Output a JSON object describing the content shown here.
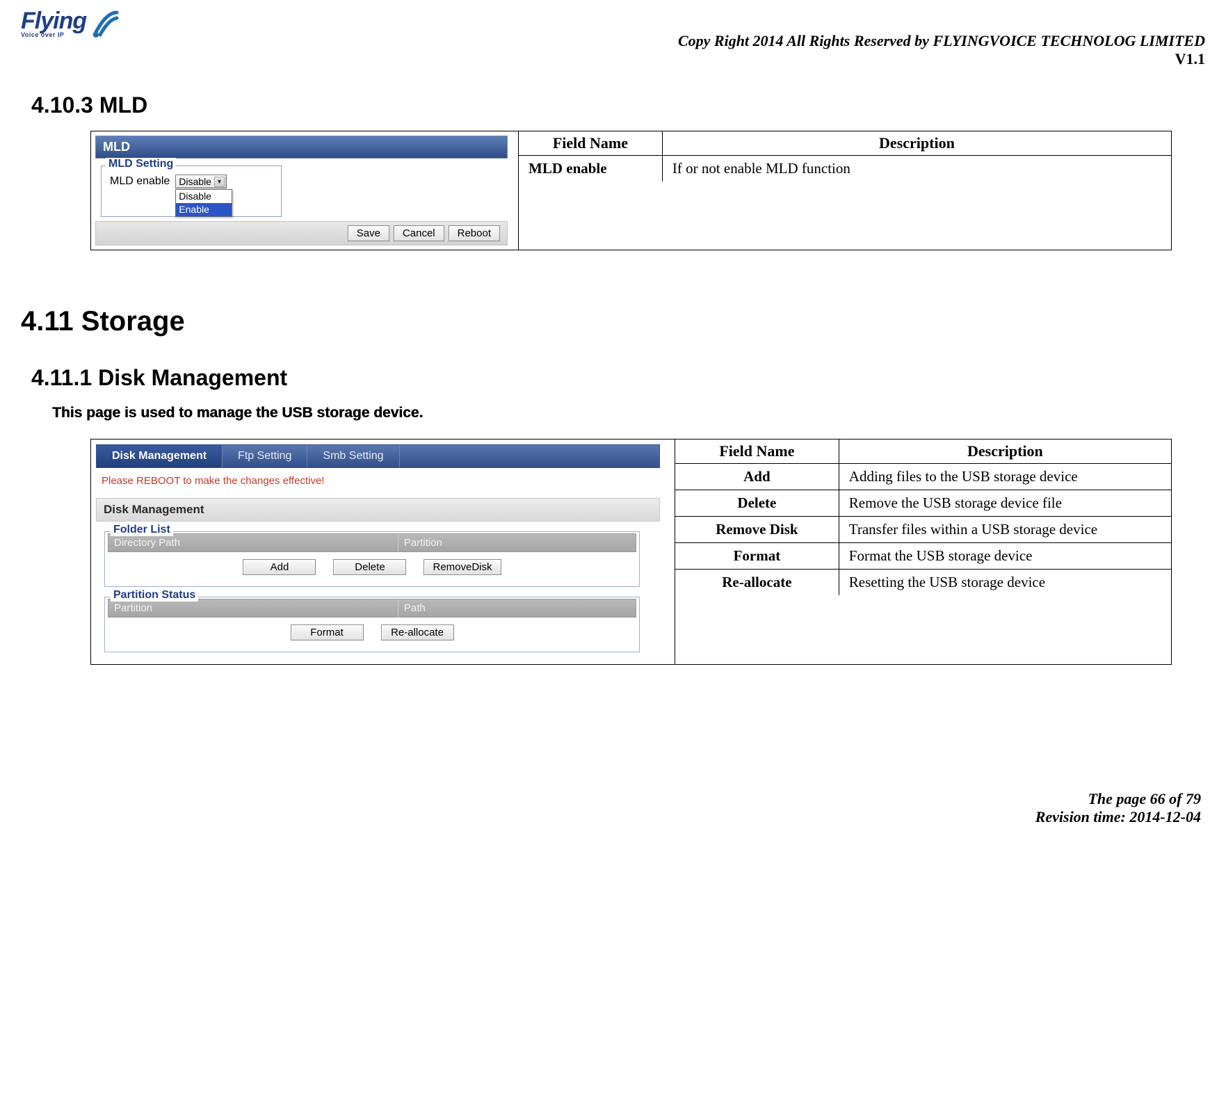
{
  "header": {
    "logo_top": "Flying",
    "logo_bottom": "Voice over IP",
    "copyright": "Copy Right 2014 All Rights Reserved by FLYINGVOICE TECHNOLOG LIMITED",
    "version": "V1.1"
  },
  "section_mld": {
    "heading": "4.10.3  MLD",
    "ui": {
      "banner": "MLD",
      "group_label": "MLD Setting",
      "row_label": "MLD enable",
      "selected": "Disable",
      "options": [
        "Disable",
        "Enable"
      ],
      "buttons": {
        "save": "Save",
        "cancel": "Cancel",
        "reboot": "Reboot"
      }
    },
    "table": {
      "head_field": "Field Name",
      "head_desc": "Description",
      "rows": [
        {
          "field": "MLD enable",
          "desc": "If or not enable MLD function"
        }
      ]
    }
  },
  "chapter_storage": {
    "heading": "4.11  Storage"
  },
  "section_disk": {
    "heading": "4.11.1  Disk Management",
    "intro": "This page is used to manage the USB storage device.",
    "ui": {
      "tabs": [
        "Disk Management",
        "Ftp Setting",
        "Smb Setting"
      ],
      "reboot_note": "Please REBOOT to make the changes effective!",
      "sec_header": "Disk Management",
      "folder_group": {
        "label": "Folder List",
        "cols": [
          "Directory Path",
          "Partition"
        ],
        "buttons": {
          "add": "Add",
          "delete": "Delete",
          "removedisk": "RemoveDisk"
        }
      },
      "partition_group": {
        "label": "Partition Status",
        "cols": [
          "Partition",
          "Path"
        ],
        "buttons": {
          "format": "Format",
          "reallocate": "Re-allocate"
        }
      }
    },
    "table": {
      "head_field": "Field Name",
      "head_desc": "Description",
      "rows": [
        {
          "field": "Add",
          "desc": "Adding files to the USB storage device"
        },
        {
          "field": "Delete",
          "desc": "Remove the USB storage device file"
        },
        {
          "field": "Remove Disk",
          "desc": "Transfer files within a USB storage device"
        },
        {
          "field": "Format",
          "desc": "Format the USB storage device"
        },
        {
          "field": "Re-allocate",
          "desc": "Resetting the USB storage device"
        }
      ]
    }
  },
  "footer": {
    "page": "The page 66 of 79",
    "revision": "Revision time: 2014-12-04"
  }
}
